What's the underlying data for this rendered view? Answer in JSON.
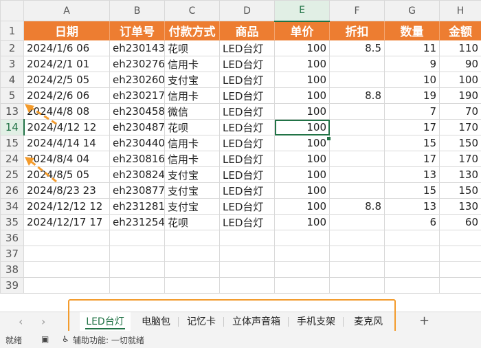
{
  "columns": [
    "A",
    "B",
    "C",
    "D",
    "E",
    "F",
    "G",
    "H"
  ],
  "headers": [
    "日期",
    "订单号",
    "付款方式",
    "商品",
    "单价",
    "折扣",
    "数量",
    "金额"
  ],
  "header_row_number": "1",
  "rows": [
    {
      "n": "2",
      "date": "2024/1/6 06",
      "order": "eh230143",
      "pay": "花呗",
      "product": "LED台灯",
      "price": "100",
      "disc": "8.5",
      "qty": "11",
      "amt": "110"
    },
    {
      "n": "3",
      "date": "2024/2/1 01",
      "order": "eh230276",
      "pay": "信用卡",
      "product": "LED台灯",
      "price": "100",
      "disc": "",
      "qty": "9",
      "amt": "90"
    },
    {
      "n": "4",
      "date": "2024/2/5 05",
      "order": "eh230260",
      "pay": "支付宝",
      "product": "LED台灯",
      "price": "100",
      "disc": "",
      "qty": "10",
      "amt": "100"
    },
    {
      "n": "5",
      "date": "2024/2/6 06",
      "order": "eh230217",
      "pay": "信用卡",
      "product": "LED台灯",
      "price": "100",
      "disc": "8.8",
      "qty": "19",
      "amt": "190"
    },
    {
      "n": "13",
      "date": "2024/4/8 08",
      "order": "eh230458",
      "pay": "微信",
      "product": "LED台灯",
      "price": "100",
      "disc": "",
      "qty": "7",
      "amt": "70"
    },
    {
      "n": "14",
      "date": "2024/4/12 12",
      "order": "eh230487",
      "pay": "花呗",
      "product": "LED台灯",
      "price": "100",
      "disc": "",
      "qty": "17",
      "amt": "170"
    },
    {
      "n": "15",
      "date": "2024/4/14 14",
      "order": "eh230440",
      "pay": "信用卡",
      "product": "LED台灯",
      "price": "100",
      "disc": "",
      "qty": "15",
      "amt": "150"
    },
    {
      "n": "24",
      "date": "2024/8/4 04",
      "order": "eh230816",
      "pay": "信用卡",
      "product": "LED台灯",
      "price": "100",
      "disc": "",
      "qty": "17",
      "amt": "170"
    },
    {
      "n": "25",
      "date": "2024/8/5 05",
      "order": "eh230824",
      "pay": "支付宝",
      "product": "LED台灯",
      "price": "100",
      "disc": "",
      "qty": "13",
      "amt": "130"
    },
    {
      "n": "26",
      "date": "2024/8/23 23",
      "order": "eh230877",
      "pay": "支付宝",
      "product": "LED台灯",
      "price": "100",
      "disc": "",
      "qty": "15",
      "amt": "150"
    },
    {
      "n": "34",
      "date": "2024/12/12 12",
      "order": "eh231281",
      "pay": "支付宝",
      "product": "LED台灯",
      "price": "100",
      "disc": "8.8",
      "qty": "13",
      "amt": "130"
    },
    {
      "n": "35",
      "date": "2024/12/17 17",
      "order": "eh231254",
      "pay": "花呗",
      "product": "LED台灯",
      "price": "100",
      "disc": "",
      "qty": "6",
      "amt": "60"
    }
  ],
  "empty_rows": [
    "36",
    "37",
    "38",
    "39"
  ],
  "tabs": [
    "LED台灯",
    "电脑包",
    "记忆卡",
    "立体声音箱",
    "手机支架",
    "麦克风"
  ],
  "active_tab": "LED台灯",
  "add_tab": "+",
  "nav_prev": "‹",
  "nav_next": "›",
  "status": {
    "ready": "就绪",
    "accessibility": "辅助功能: 一切就绪"
  },
  "colors": {
    "header_fill": "#ed7d31",
    "highlight": "#f39b2c",
    "excel_green": "#217346"
  }
}
